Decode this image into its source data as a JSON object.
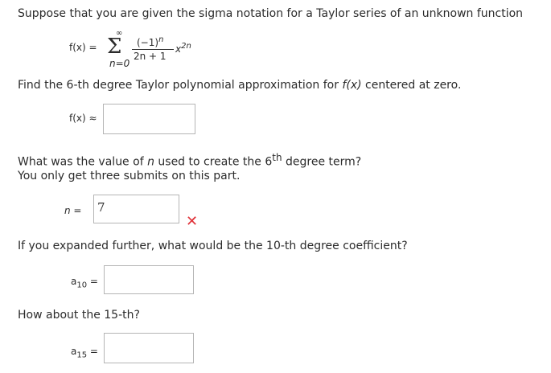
{
  "intro": "Suppose that you are given the sigma notation for a Taylor series of an unknown function",
  "formula": {
    "lhs": "f(x) =",
    "sum_symbol": "Σ",
    "upper_limit": "∞",
    "lower_limit": "n=0",
    "numerator": "(−1)",
    "numerator_exp": "n",
    "denominator": "2n + 1",
    "variable": "x",
    "variable_exp": "2n"
  },
  "q1": {
    "text_before": "Find the 6-th degree Taylor polynomial approximation for ",
    "fx": "f(x)",
    "text_after": " centered at zero.",
    "label": "f(x) ≈",
    "value": ""
  },
  "q2": {
    "line1_before": "What was the value of ",
    "line1_var": "n",
    "line1_mid": " used to create the 6",
    "line1_sup": "th",
    "line1_after": " degree term?",
    "line2": "You only get three submits on this part.",
    "label": "n =",
    "value": "7",
    "status_icon": "x-mark-icon",
    "status_color": "#e0333a"
  },
  "q3": {
    "text": "If you expanded further, what would be the 10-th degree coefficient?",
    "label_a": "a",
    "label_sub": "10",
    "label_eq": "=",
    "value": ""
  },
  "q4": {
    "text": "How about the 15-th?",
    "label_a": "a",
    "label_sub": "15",
    "label_eq": "=",
    "value": ""
  }
}
